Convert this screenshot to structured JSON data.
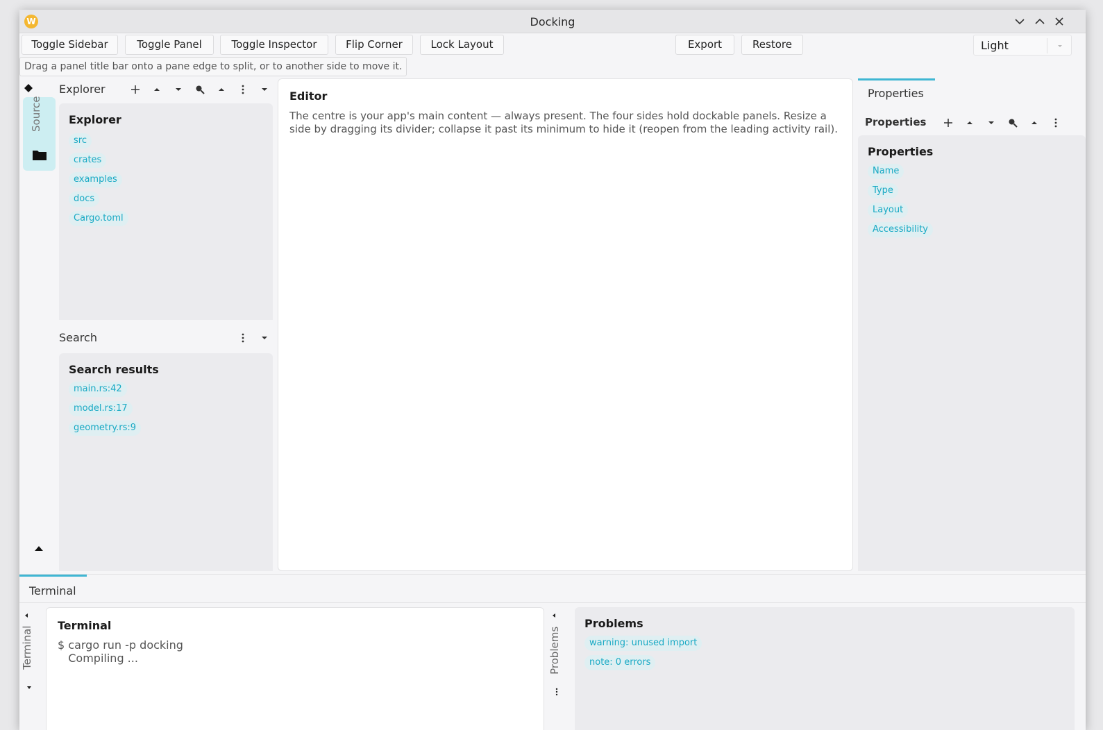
{
  "window": {
    "title": "Docking",
    "app_icon_letter": "W"
  },
  "toolbar": {
    "toggle_sidebar": "Toggle Sidebar",
    "toggle_panel": "Toggle Panel",
    "toggle_inspector": "Toggle Inspector",
    "flip_corner": "Flip Corner",
    "lock_layout": "Lock Layout",
    "export": "Export",
    "restore": "Restore",
    "theme_value": "Light"
  },
  "hint": "Drag a panel title bar onto a pane edge to split, or to another side to move it.",
  "rail": {
    "source_label": "Source"
  },
  "explorer": {
    "header": "Explorer",
    "title": "Explorer",
    "items": [
      "src",
      "crates",
      "examples",
      "docs",
      "Cargo.toml"
    ]
  },
  "search": {
    "header": "Search",
    "title": "Search results",
    "items": [
      "main.rs:42",
      "model.rs:17",
      "geometry.rs:9"
    ]
  },
  "editor": {
    "title": "Editor",
    "text": "The centre is your app's main content — always present. The four sides hold dockable panels. Resize a side by dragging its divider; collapse it past its minimum to hide it (reopen from the leading activity rail)."
  },
  "properties": {
    "tab": "Properties",
    "header": "Properties",
    "title": "Properties",
    "items": [
      "Name",
      "Type",
      "Layout",
      "Accessibility"
    ]
  },
  "bottom": {
    "tab": "Terminal",
    "terminal_vertical": "Terminal",
    "problems_vertical": "Problems",
    "terminal": {
      "title": "Terminal",
      "lines": [
        "$ cargo run -p docking",
        "   Compiling ..."
      ]
    },
    "problems": {
      "title": "Problems",
      "items": [
        "warning: unused import",
        "note: 0 errors"
      ]
    }
  },
  "colors": {
    "accent": "#3fb6d3",
    "chip_text": "#18a9c4",
    "chip_bg": "#dfeff2",
    "rail_bg": "#cdeef2"
  }
}
